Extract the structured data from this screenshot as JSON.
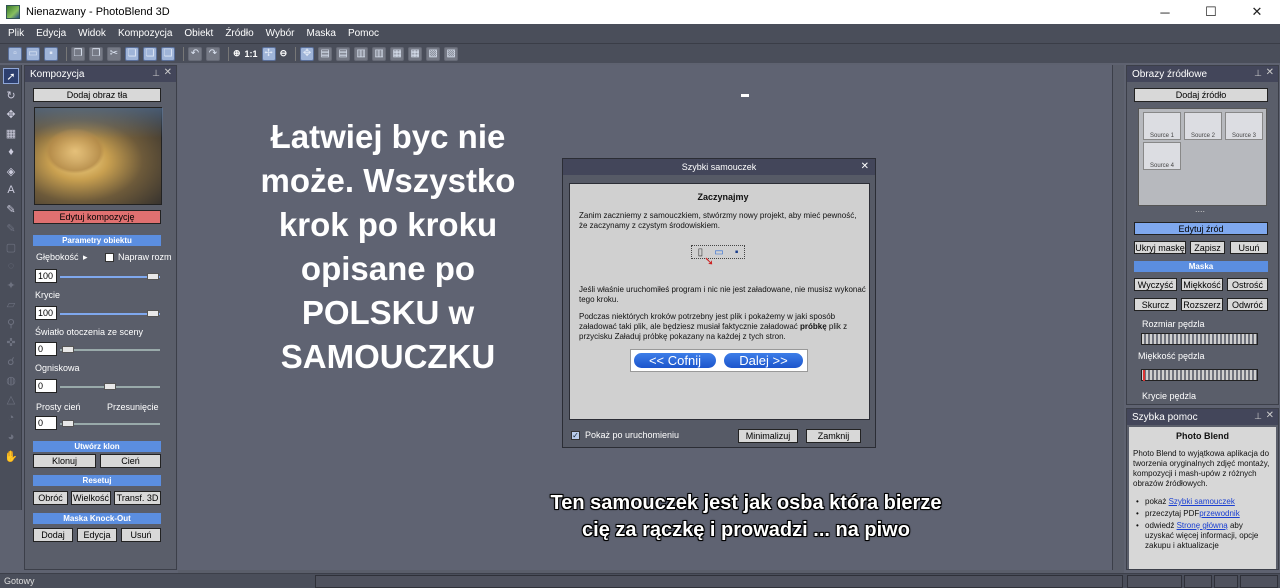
{
  "window": {
    "title": "Nienazwany - PhotoBlend 3D",
    "min": "─",
    "max": "☐",
    "close": "✕"
  },
  "menu": [
    "Plik",
    "Edycja",
    "Widok",
    "Kompozycja",
    "Obiekt",
    "Źródło",
    "Wybór",
    "Maska",
    "Pomoc"
  ],
  "toolbar": {
    "zoom_label": "1:1"
  },
  "left_panel": {
    "title": "Kompozycja",
    "add_background": "Dodaj obraz tła",
    "edit_composition": "Edytuj kompozycję",
    "params_header": "Parametry obiektu",
    "depth_label": "Głębokość",
    "fix_floor_label": "Napraw rozm",
    "depth_value": "100",
    "opacity_label": "Krycie",
    "opacity_value": "100",
    "ambient_label": "Światło otoczenia ze sceny",
    "ambient_value": "0",
    "focal_label": "Ogniskowa",
    "focal_value": "0",
    "shadow_label": "Prosty cień",
    "shift_label": "Przesunięcie",
    "shadow_value": "0",
    "clone_header": "Utwórz klon",
    "clone_btn": "Klonuj",
    "shadow_btn": "Cień",
    "reset_header": "Resetuj",
    "rotate_btn": "Obróć",
    "size_btn": "Wielkość",
    "transf_btn": "Transf. 3D",
    "knockout_header": "Maska Knock-Out",
    "add_btn": "Dodaj",
    "edit_btn": "Edycja",
    "remove_btn": "Usuń"
  },
  "overlay": {
    "big_text_lines": [
      "Łatwiej byc nie",
      "może. Wszystko",
      "krok po kroku",
      "opisane po",
      "POLSKU w",
      "SAMOUCZKU"
    ],
    "caption_lines": [
      "Ten samouczek jest jak osba która bierze",
      "cię za rączkę i prowadzi ... na piwo"
    ]
  },
  "dialog": {
    "title": "Szybki samouczek",
    "heading": "Zaczynajmy",
    "para1": "Zanim zaczniemy z samouczkiem, stwórzmy nowy projekt, aby mieć pewność, że zaczynamy z czystym środowiskiem.",
    "para2": "Jeśli właśnie uruchomiłeś program i nic nie jest załadowane, nie musisz wykonać tego kroku.",
    "para3_a": "Podczas niektórych kroków potrzebny jest plik i pokażemy w jaki sposób załadować taki plik, ale będziesz musiał faktycznie załadować ",
    "para3_bold": "próbkę",
    "para3_b": " plik z przycisku Załaduj próbkę pokazany na każdej z tych stron.",
    "back_btn": "<< Cofnij",
    "next_btn": "Dalej >>",
    "show_on_start": "Pokaż po uruchomieniu",
    "minimize_btn": "Minimalizuj",
    "close_btn": "Zamknij"
  },
  "right_panel": {
    "title": "Obrazy źródłowe",
    "add_source": "Dodaj źródło",
    "thumbs": [
      "Source 1",
      "Source 2",
      "Source 3",
      "Source 4"
    ],
    "dots": "....",
    "edit_source": "Edytuj źród",
    "hide_mask": "Ukryj maskę",
    "save": "Zapisz",
    "remove": "Usuń",
    "mask_header": "Maska",
    "clear": "Wyczyść",
    "softness": "Miękkość",
    "sharpness": "Ostrość",
    "shrink": "Skurcz",
    "expand": "Rozszerz",
    "invert": "Odwróć",
    "brush_size": "Rozmiar pędzla",
    "brush_softness": "Miękkość pędzla",
    "brush_opacity": "Krycie pędzla"
  },
  "help_panel": {
    "title": "Szybka pomoc",
    "heading": "Photo Blend",
    "intro": "Photo Blend to wyjątkowa aplikacja do tworzenia oryginalnych zdjęć montaży, kompozycji i mash-upów z różnych obrazów źródłowych.",
    "item1_pre": "pokaż ",
    "item1_link": "Szybki samouczek",
    "item2_pre": "przeczytaj PDF",
    "item2_link": "przewodnik",
    "item3_pre": "odwiedź ",
    "item3_link": "Stronę główną",
    "item3_post": " aby uzyskać więcej informacji, opcje zakupu i aktualizacje"
  },
  "status": {
    "text": "Gotowy"
  }
}
